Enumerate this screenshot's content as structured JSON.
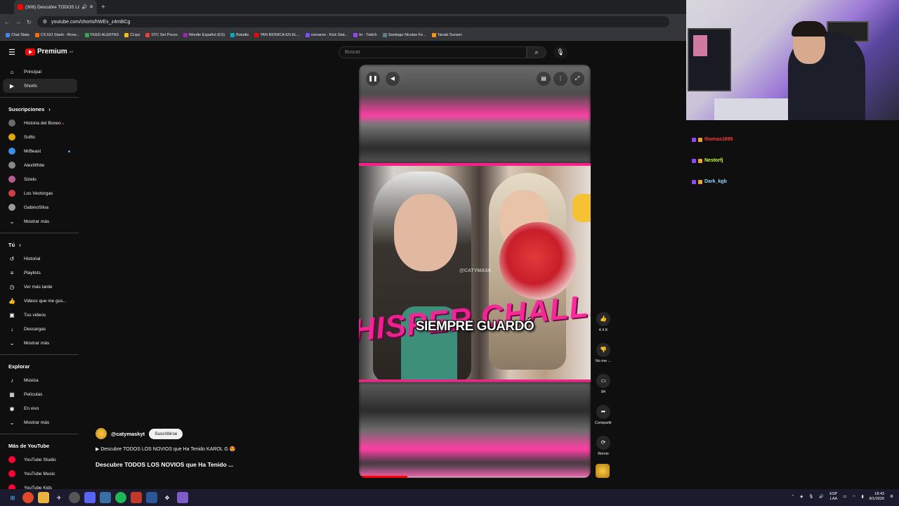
{
  "browser": {
    "tab_title": "(308) Descubre TODOS LO...",
    "url": "youtube.com/shorts/hWEx_z4mBCg",
    "bookmarks": [
      "Chat Stats",
      "CS:GO Stash - Brow...",
      "FEED ALERTAS",
      "CLips",
      "STC Set Prices",
      "Wordle Español (ES)",
      "Boludle",
      "TAN BIONICA EN EL...",
      "sionaron - Kick Stat...",
      "trr - Twitch",
      "Santiago Nicolas Fe...",
      "Tanuki Sunset"
    ]
  },
  "header": {
    "logo_text": "Premium",
    "logo_region": "AR",
    "search_placeholder": "Buscar"
  },
  "sidebar": {
    "main": [
      {
        "label": "Principal",
        "icon": "home-icon",
        "glyph": "⌂"
      },
      {
        "label": "Shorts",
        "icon": "shorts-icon",
        "glyph": "▶"
      }
    ],
    "subs_title": "Suscripciones",
    "subs": [
      {
        "label": "Historia del Boxeo",
        "color": "#6b6b6b",
        "live": true
      },
      {
        "label": "Softic",
        "color": "#e0a800"
      },
      {
        "label": "MrBeast",
        "color": "#3a8ee6",
        "dot": true
      },
      {
        "label": "AlexWhite",
        "color": "#888888"
      },
      {
        "label": "Sizelu",
        "color": "#b06090"
      },
      {
        "label": "Los Vectorgas",
        "color": "#d04040"
      },
      {
        "label": "GabinoSilva",
        "color": "#9a9a9a"
      }
    ],
    "show_more": "Mostrar más",
    "you_title": "Tú",
    "you": [
      {
        "label": "Historial",
        "icon": "history-icon",
        "glyph": "↺"
      },
      {
        "label": "Playlists",
        "icon": "playlist-icon",
        "glyph": "≡"
      },
      {
        "label": "Ver más tarde",
        "icon": "clock-icon",
        "glyph": "◷"
      },
      {
        "label": "Videos que me gus...",
        "icon": "like-icon",
        "glyph": "👍"
      },
      {
        "label": "Tus videos",
        "icon": "video-icon",
        "glyph": "▣"
      },
      {
        "label": "Descargas",
        "icon": "download-icon",
        "glyph": "↓"
      }
    ],
    "explore_title": "Explorar",
    "explore": [
      {
        "label": "Música",
        "icon": "music-icon",
        "glyph": "♪"
      },
      {
        "label": "Películas",
        "icon": "film-icon",
        "glyph": "▦"
      },
      {
        "label": "En vivo",
        "icon": "live-icon",
        "glyph": "◉"
      }
    ],
    "more_title": "Más de YouTube",
    "more": [
      {
        "label": "YouTube Studio",
        "color": "#ff0033"
      },
      {
        "label": "YouTube Music",
        "color": "#ff0033"
      },
      {
        "label": "YouTube Kids",
        "color": "#ff0033"
      }
    ]
  },
  "video": {
    "channel": "@catymaskyt",
    "subscribe": "Suscribirse",
    "playlist_line": "▶ Descubre TODOS LOS NOVIOS que Ha Tenido KAROL G 😍",
    "title": "Descubre TODOS LOS NOVIOS que Ha Tenido ...",
    "caption": "SIEMPRE GUARDÓ",
    "banner": "HISPER CHALLENG",
    "watermark": "@CATYMASK",
    "progress": 0.21
  },
  "actions": {
    "likes": "4.4 K",
    "dislike": "No me ...",
    "comments": "84",
    "share": "Compartir",
    "remix": "Remix"
  },
  "chat": [
    {
      "user": "thomas1695",
      "color": "#ff3b3b"
    },
    {
      "user": "Nestorfj",
      "color": "#c6ff3a"
    },
    {
      "user": "Dark_kgb",
      "color": "#8fd8ff"
    }
  ],
  "tray": {
    "lang": "ESP",
    "region": "LAA",
    "time": "18:43",
    "date": "8/1/2026"
  }
}
